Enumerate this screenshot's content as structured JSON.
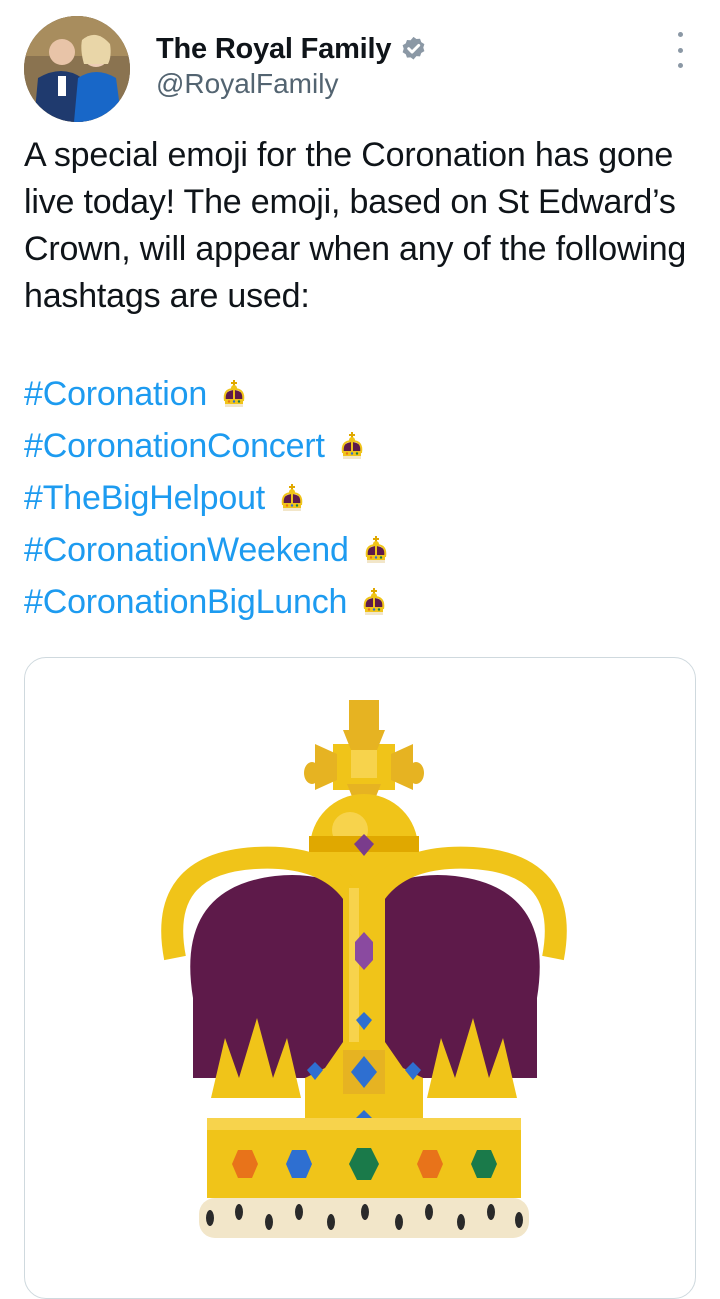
{
  "tweet": {
    "author": {
      "display_name": "The Royal Family",
      "handle": "@RoyalFamily",
      "verified": true,
      "verified_color": "#8b98a5"
    },
    "paragraph": "A special emoji for the Coronation has gone live today! The emoji, based on St Edward’s Crown, will appear when any of the following hashtags are used:",
    "hashtags": [
      "#Coronation",
      "#CoronationConcert",
      "#TheBigHelpout",
      "#CoronationWeekend",
      "#CoronationBigLunch"
    ],
    "hashtag_emoji": "crown-icon",
    "hashtag_color": "#1d9bf0",
    "media": {
      "subject": "crown-icon",
      "colors": {
        "gold": "#f0c419",
        "velvet": "#5e1a4a",
        "ermine": "#f2e6c9"
      }
    }
  }
}
